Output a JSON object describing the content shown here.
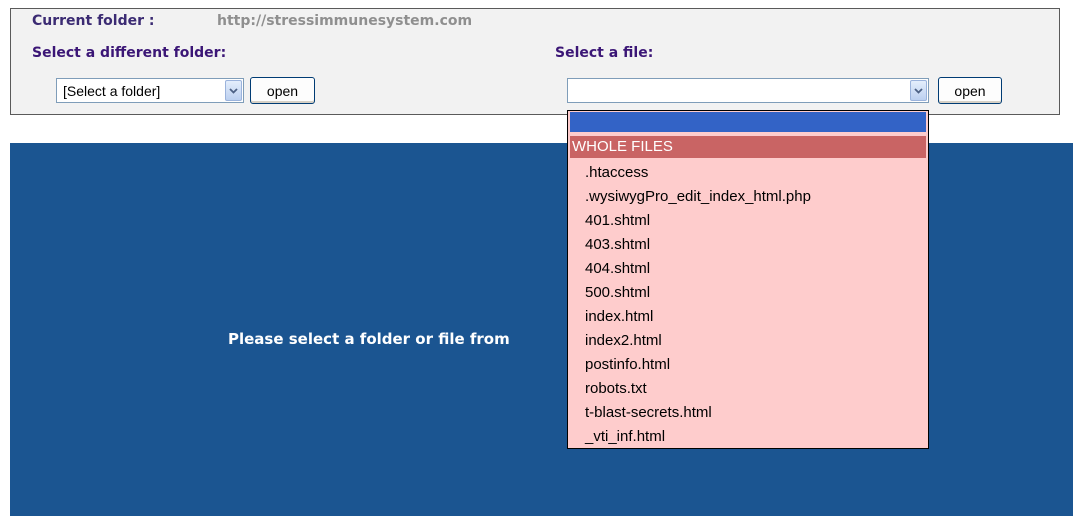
{
  "header": {
    "current_folder_label": "Current folder :",
    "current_folder_value": "http://stressimmunesystem.com",
    "folder_select_label": "Select a different folder:",
    "file_select_label": "Select a file:"
  },
  "folder_select": {
    "selected": "[Select a folder]",
    "open_label": "open"
  },
  "file_select": {
    "selected": "",
    "open_label": "open",
    "options": {
      "blank": "",
      "group_label": "WHOLE FILES",
      "items": [
        ".htaccess",
        ".wysiwygPro_edit_index_html.php",
        "401.shtml",
        "403.shtml",
        "404.shtml",
        "500.shtml",
        "index.html",
        "index2.html",
        "postinfo.html",
        "robots.txt",
        "t-blast-secrets.html",
        "_vti_inf.html"
      ]
    }
  },
  "main": {
    "message": "Please select a folder or file from"
  },
  "colors": {
    "panel_bg": "#f2f2f2",
    "main_bg": "#1b5591",
    "label_color": "#3b1676",
    "highlight": "#3363c6",
    "group_bg": "#c96464",
    "dropdown_bg": "#fecccc"
  }
}
